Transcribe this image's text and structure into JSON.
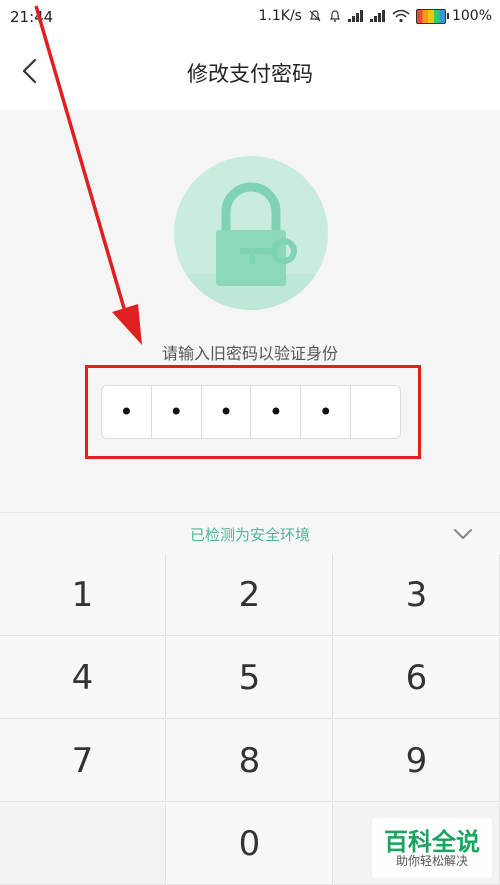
{
  "status": {
    "time": "21:44",
    "speed": "1.1K/s",
    "battery": "100%"
  },
  "header": {
    "title": "修改支付密码"
  },
  "main": {
    "prompt": "请输入旧密码以验证身份",
    "pin_filled": [
      "•",
      "•",
      "•",
      "•",
      "•",
      ""
    ]
  },
  "keyboard": {
    "security_label": "已检测为安全环境",
    "keys": [
      "1",
      "2",
      "3",
      "4",
      "5",
      "6",
      "7",
      "8",
      "9",
      "",
      "0",
      ""
    ]
  },
  "watermark": {
    "title": "百科全说",
    "subtitle": "助你轻松解决"
  },
  "colors": {
    "accent": "#4cb894",
    "highlight": "#e02020"
  }
}
